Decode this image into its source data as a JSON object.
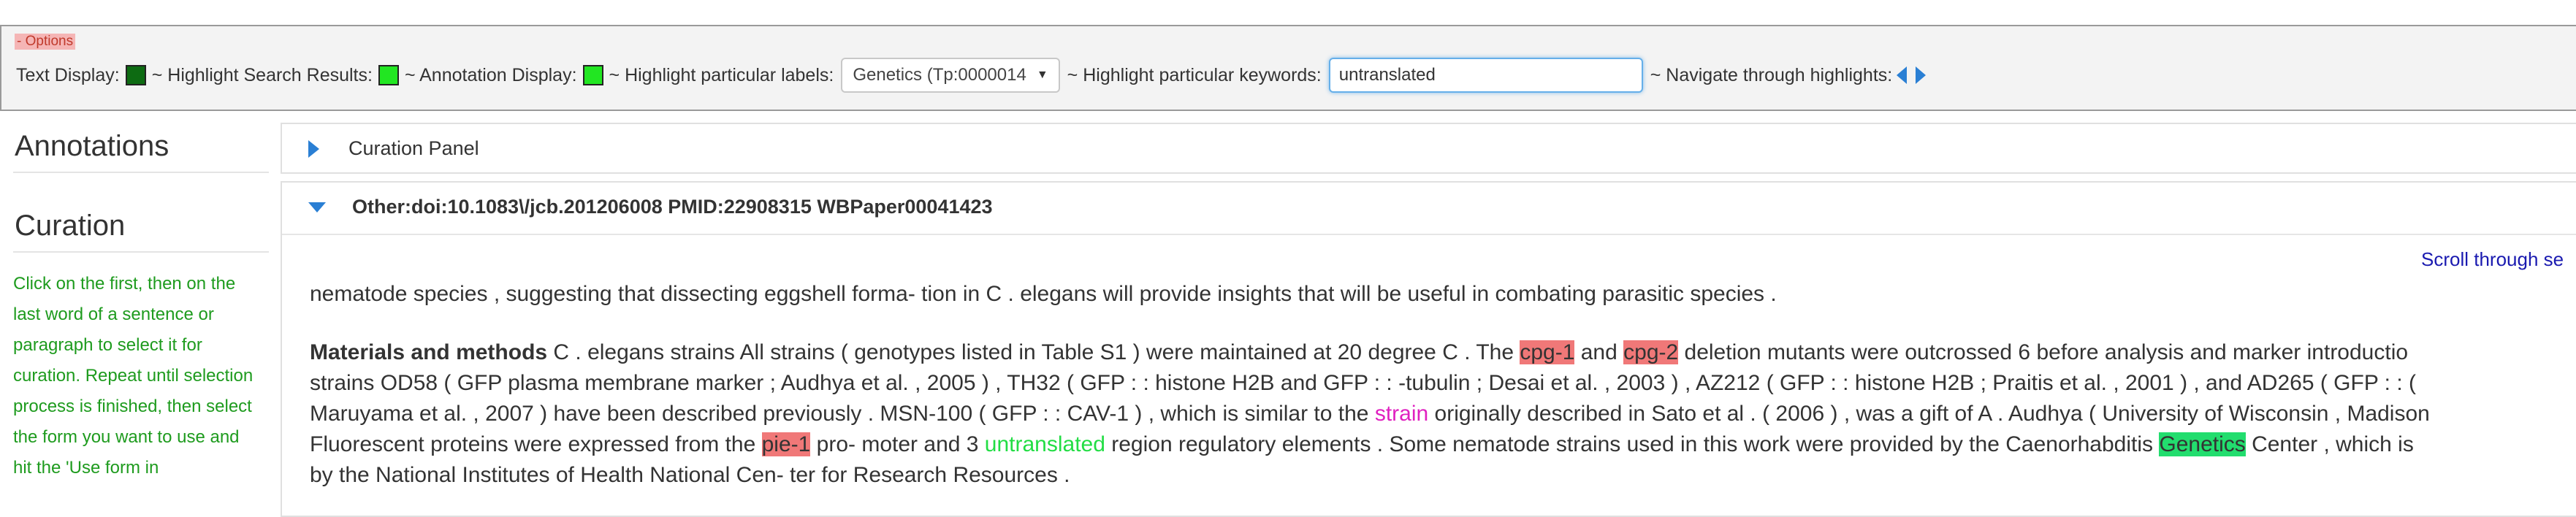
{
  "options": {
    "legend": "- Options",
    "text_display_label": "Text Display:",
    "highlight_search_label": "~ Highlight Search Results:",
    "annotation_display_label": "~ Annotation Display:",
    "highlight_labels_label": "~ Highlight particular labels:",
    "labels_select_value": "Genetics (Tp:0000014",
    "highlight_keywords_label": "~ Highlight particular keywords:",
    "keywords_input_value": "untranslated",
    "navigate_label": "~ Navigate through highlights:",
    "colors": {
      "text_display": "#0d6b12",
      "highlight_search": "#22e622",
      "annotation_display": "#22e622"
    }
  },
  "sidebar": {
    "annotations_heading": "Annotations",
    "curation_heading": "Curation",
    "instructions": "Click on the first, then on the last word of a sentence or paragraph to select it for curation. Repeat until selection process is finished, then select the form you want to use and hit the 'Use form in"
  },
  "curation_panel": {
    "title": "Curation Panel"
  },
  "paper_panel": {
    "title": "Other:doi:10.1083\\/jcb.201206008 PMID:22908315 WBPaper00041423",
    "scroll_link": "Scroll through se",
    "line1": "nematode species , suggesting that dissecting eggshell forma- tion in C . elegans will provide insights that will be useful in combating parasitic species .",
    "p2": {
      "heading": "Materials and methods",
      "l1a": " C . elegans strains All strains ( genotypes listed in Table S1 ) were maintained at 20 degree C . The ",
      "cpg1": "cpg-1",
      "and": " and ",
      "cpg2": "cpg-2",
      "l1b": " deletion mutants were outcrossed 6 before analysis and marker introductio",
      "l2": "strains OD58 ( GFP plasma membrane marker ; Audhya et al. , 2005 ) , TH32 ( GFP : : histone H2B and GFP : : -tubulin ; Desai et al. , 2003 ) , AZ212 ( GFP : : histone H2B ; Praitis et al. , 2001 ) , and AD265 ( GFP : : (",
      "l3a": "Maruyama et al. , 2007 ) have been described previously . MSN-100 ( GFP : : CAV-1 ) , which is similar to the ",
      "strain": "strain",
      "l3b": " originally described in Sato et al . ( 2006 ) , was a gift of A . Audhya ( University of Wisconsin , Madison",
      "l4a": "Fluorescent proteins were expressed from the ",
      "pie1": "pie-1",
      "l4b": " pro- moter and 3 ",
      "untranslated": "untranslated",
      "l4c": " region regulatory elements . Some nematode strains used in this work were provided by the Caenorhabditis ",
      "genetics": "Genetics",
      "l4d": " Center , which is",
      "l5": "by the National Institutes of Health National Cen- ter for Research Resources ."
    }
  }
}
